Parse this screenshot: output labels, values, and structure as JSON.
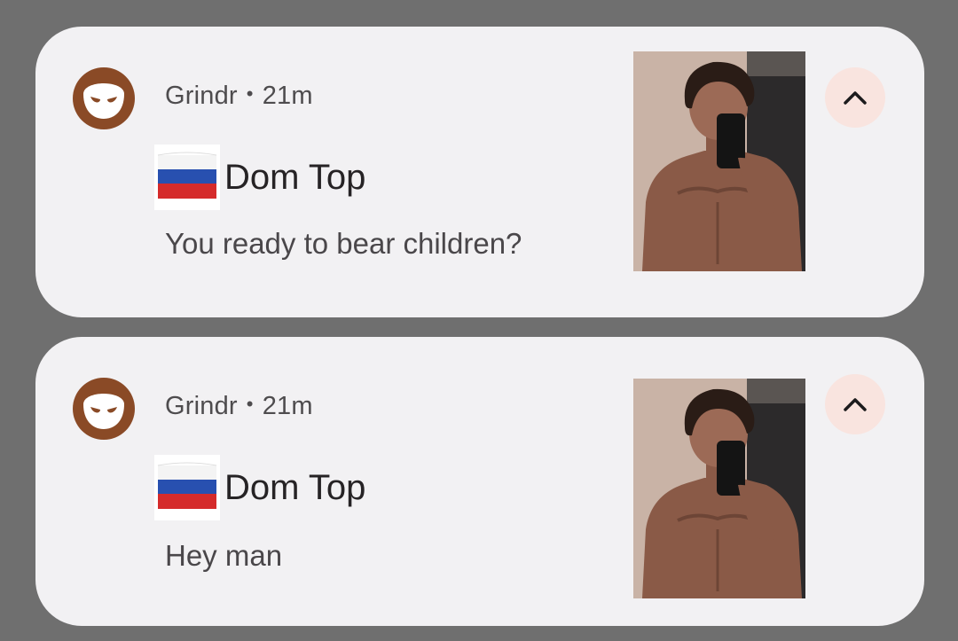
{
  "notifications": [
    {
      "app_name": "Grindr",
      "time": "21m",
      "title": "Dom Top",
      "message": "You ready to bear children?",
      "flag": "russia-flag-emoji",
      "thumbnail": "profile-photo"
    },
    {
      "app_name": "Grindr",
      "time": "21m",
      "title": "Dom Top",
      "message": "Hey man",
      "flag": "russia-flag-emoji",
      "thumbnail": "profile-photo"
    }
  ],
  "separator": "•",
  "icons": {
    "app": "grindr-mask-icon",
    "expand": "chevron-up-icon"
  },
  "colors": {
    "background": "#6f6f6f",
    "card": "#f2f1f3",
    "app_icon": "#8a4a26",
    "expand_bg": "#f9e4df",
    "flag_white": "#ffffff",
    "flag_blue": "#2850b0",
    "flag_red": "#d52b2b"
  }
}
